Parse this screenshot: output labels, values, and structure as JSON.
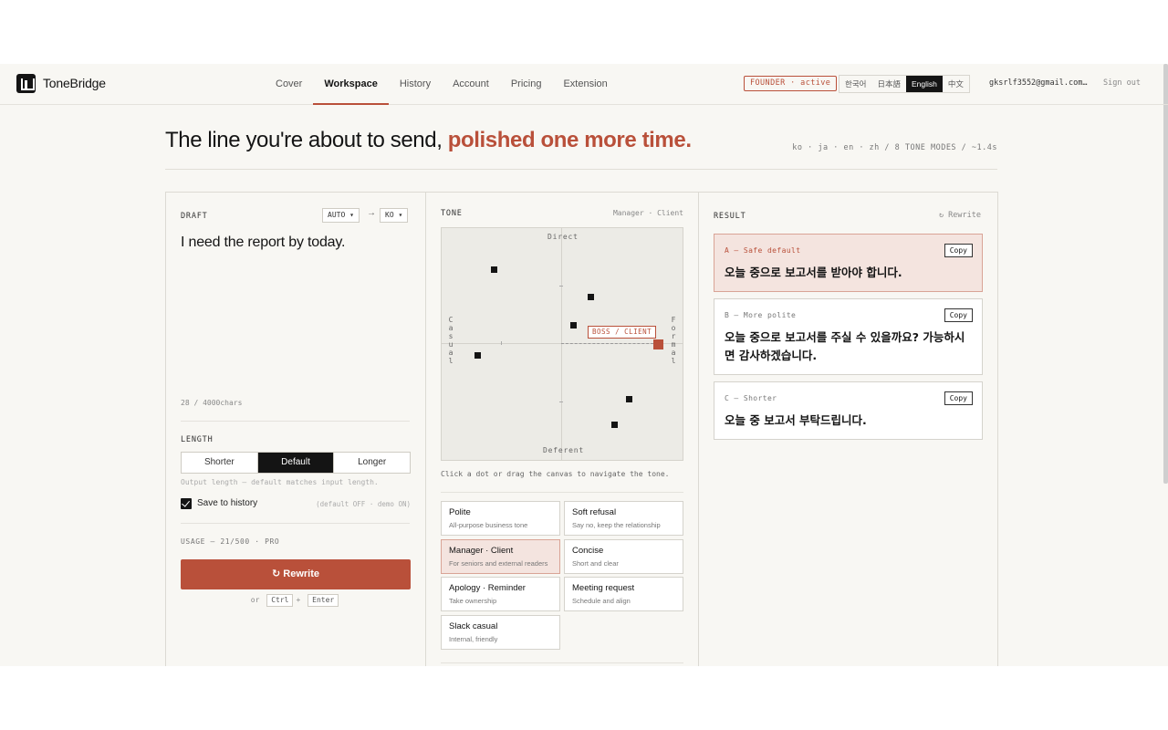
{
  "header": {
    "brand": "ToneBridge",
    "nav": [
      "Cover",
      "Workspace",
      "History",
      "Account",
      "Pricing",
      "Extension"
    ],
    "active_nav": "Workspace",
    "plan_badge": "FOUNDER · active",
    "languages": [
      "한국어",
      "日本語",
      "English",
      "中文"
    ],
    "active_language": "English",
    "email": "gksrlf3552@gmail.com…",
    "sign_out": "Sign out"
  },
  "hero": {
    "title_plain": "The line you're about to send, ",
    "title_accent": "polished one more time.",
    "meta": "ko · ja · en · zh / 8 TONE MODES / ~1.4s"
  },
  "draft": {
    "label": "DRAFT",
    "source_lang": "AUTO ▾",
    "arrow": "→",
    "target_lang": "KO ▾",
    "text": "I need the report by today.",
    "char_count": "28 / 4000chars",
    "length_label": "LENGTH",
    "length_options": [
      "Shorter",
      "Default",
      "Longer"
    ],
    "length_selected": "Default",
    "length_hint": "Output length — default matches input length.",
    "save_label": "Save to history",
    "save_checked": true,
    "save_hint": "(default OFF · demo ON)",
    "usage": "USAGE — 21/500 · PRO",
    "rewrite_button": "↻ Rewrite",
    "shortcut_or": "or",
    "shortcut_key1": "Ctrl",
    "shortcut_plus": "+",
    "shortcut_key2": "Enter"
  },
  "tone": {
    "label": "TONE",
    "relation": "Manager · Client",
    "axis_top": "Direct",
    "axis_bottom": "Deferent",
    "axis_left": "Casual",
    "axis_right": "Formal",
    "selected_tag": "BOSS / CLIENT",
    "canvas_hint": "Click a dot or drag the canvas to navigate the tone.",
    "selected_mode": "Manager · Client",
    "modes": [
      {
        "title": "Polite",
        "subtitle": "All-purpose business tone"
      },
      {
        "title": "Soft refusal",
        "subtitle": "Say no, keep the relationship"
      },
      {
        "title": "Manager · Client",
        "subtitle": "For seniors and external readers"
      },
      {
        "title": "Concise",
        "subtitle": "Short and clear"
      },
      {
        "title": "Apology · Reminder",
        "subtitle": "Take ownership"
      },
      {
        "title": "Meeting request",
        "subtitle": "Schedule and align"
      },
      {
        "title": "Slack casual",
        "subtitle": "Internal, friendly"
      }
    ]
  },
  "result": {
    "label": "RESULT",
    "rewrite_link": "↻ Rewrite",
    "copy_label": "Copy",
    "options": [
      {
        "label": "A — Safe default",
        "text": "오늘 중으로 보고서를 받아야 합니다."
      },
      {
        "label": "B — More polite",
        "text": "오늘 중으로 보고서를 주실 수 있을까요? 가능하시면 감사하겠습니다."
      },
      {
        "label": "C — Shorter",
        "text": "오늘 중 보고서 부탁드립니다."
      }
    ]
  },
  "colors": {
    "accent": "#b9503a",
    "ink": "#141414",
    "surface": "#f8f7f3",
    "canvas": "#ecebe6",
    "active_card": "#f4e4df"
  }
}
